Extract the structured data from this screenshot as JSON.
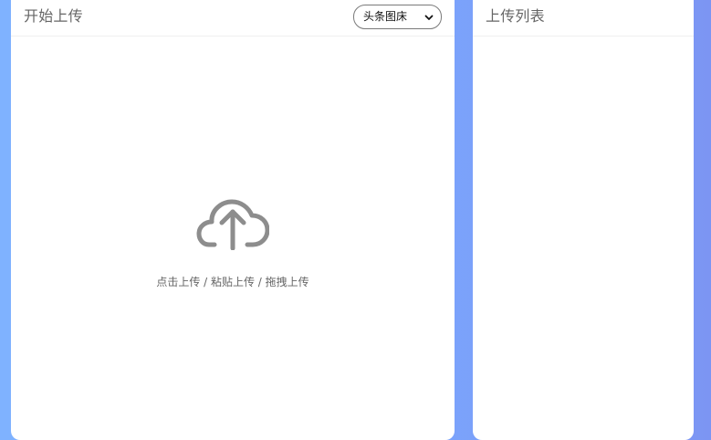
{
  "left_panel": {
    "title": "开始上传",
    "host_select": {
      "selected": "头条图床"
    },
    "upload_zone": {
      "hint": "点击上传 / 粘贴上传 / 拖拽上传",
      "icon": "cloud-upload-icon"
    }
  },
  "right_panel": {
    "title": "上传列表"
  },
  "colors": {
    "background_start": "#7fb2ff",
    "background_end": "#7c95f3",
    "panel_background": "#ffffff",
    "title_text": "#666666",
    "icon_gray": "#8d8d8d"
  }
}
